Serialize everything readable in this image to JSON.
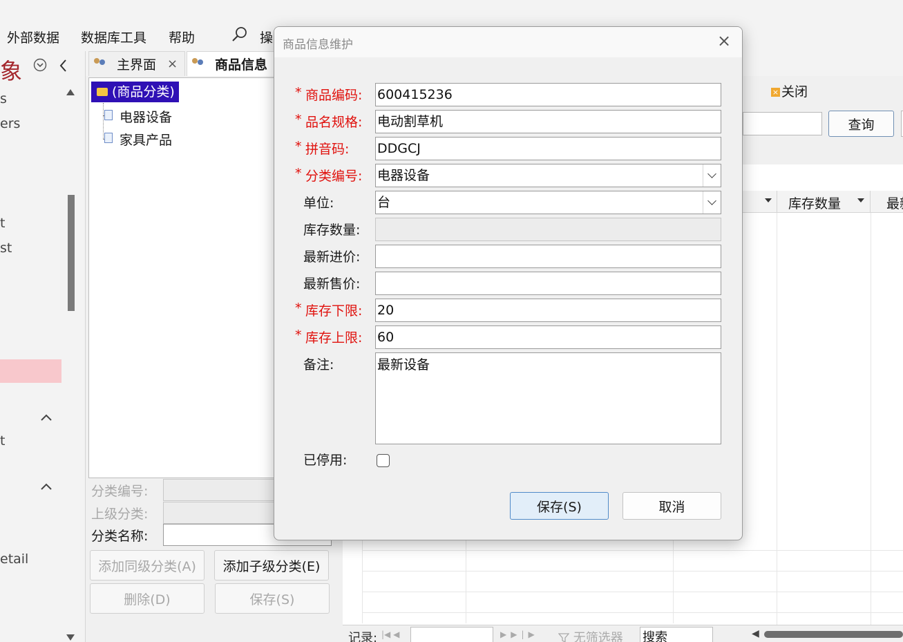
{
  "app": {
    "menu": [
      {
        "label": "外部数据"
      },
      {
        "label": "数据库工具"
      },
      {
        "label": "帮助"
      },
      {
        "label": "操"
      }
    ]
  },
  "nav": {
    "title": "象",
    "fragments": [
      "s",
      "ers",
      "t",
      "st",
      "t",
      "etail"
    ]
  },
  "tabs": [
    {
      "label": "主界面",
      "close": "×"
    },
    {
      "label": "商品信息"
    }
  ],
  "left": {
    "tree": {
      "root": "(商品分类)",
      "children": [
        "电器设备",
        "家具产品"
      ]
    },
    "fields": {
      "category_code": "分类编号:",
      "parent_category": "上级分类:",
      "category_name": "分类名称:"
    },
    "buttons": {
      "add_sibling": "添加同级分类(A)",
      "add_child": "添加子级分类(E)",
      "delete": "删除(D)",
      "save": "保存(S)"
    }
  },
  "right": {
    "close_label": "关闭",
    "query_label": "查询",
    "columns": [
      "库存数量",
      "最新"
    ]
  },
  "recordbar": {
    "label": "记录:",
    "filter_label": "无筛选器",
    "search_label": "搜索"
  },
  "dialog": {
    "title": "商品信息维护",
    "close": "×",
    "fields": {
      "code": {
        "label": "商品编码:",
        "value": "600415236",
        "required": true
      },
      "name": {
        "label": "品名规格:",
        "value": "电动割草机",
        "required": true
      },
      "pinyin": {
        "label": "拼音码:",
        "value": "DDGCJ",
        "required": true
      },
      "category": {
        "label": "分类编号:",
        "value": "电器设备",
        "required": true
      },
      "unit": {
        "label": "单位:",
        "value": "台",
        "required": false
      },
      "stock": {
        "label": "库存数量:",
        "value": "",
        "required": false
      },
      "last_purchase": {
        "label": "最新进价:",
        "value": "",
        "required": false
      },
      "last_sale": {
        "label": "最新售价:",
        "value": "",
        "required": false
      },
      "stock_min": {
        "label": "库存下限:",
        "value": "20",
        "required": true
      },
      "stock_max": {
        "label": "库存上限:",
        "value": "60",
        "required": true
      },
      "remark": {
        "label": "备注:",
        "value": "最新设备",
        "required": false
      },
      "disabled": {
        "label": "已停用:",
        "checked": false,
        "required": false
      }
    },
    "required_mark": "*",
    "save_label": "保存(S)",
    "cancel_label": "取消"
  },
  "colors": {
    "required": "#e0110d",
    "tree_selection": "#2f10b5",
    "nav_title": "#a4262c",
    "annotation_arrow": "#ff1a1a"
  }
}
